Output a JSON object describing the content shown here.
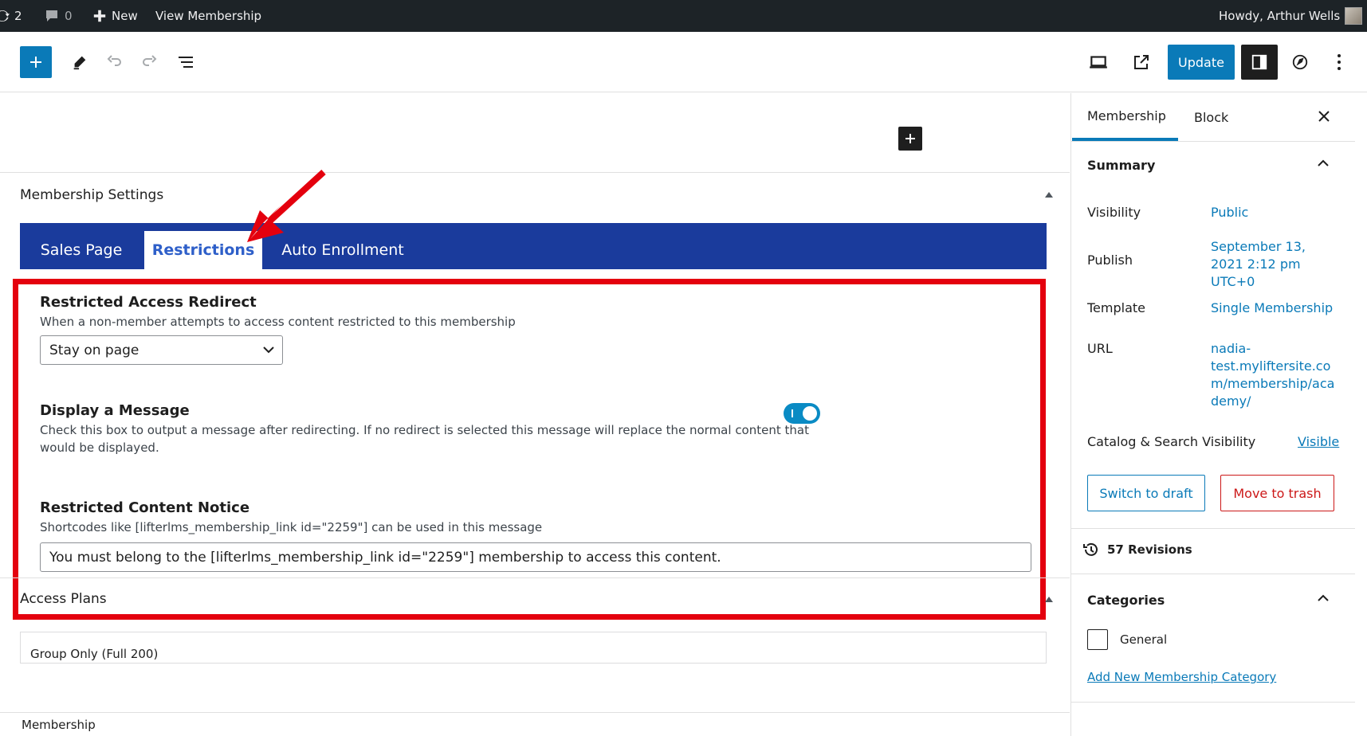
{
  "adminbar": {
    "updates_count": "2",
    "comments_count": "0",
    "new_label": "New",
    "view_label": "View Membership",
    "greeting": "Howdy, Arthur Wells"
  },
  "toolbar": {
    "update_label": "Update"
  },
  "main": {
    "settings_title": "Membership Settings",
    "tabs": [
      "Sales Page",
      "Restrictions",
      "Auto Enrollment"
    ],
    "active_tab": "Restrictions",
    "redirect": {
      "title": "Restricted Access Redirect",
      "description": "When a non-member attempts to access content restricted to this membership",
      "selected": "Stay on page"
    },
    "message": {
      "title": "Display a Message",
      "description_line1": "Check this box to output a message after redirecting. If no redirect is selected this message will replace the normal content that",
      "description_line2": "would be displayed.",
      "enabled": true
    },
    "notice": {
      "title": "Restricted Content Notice",
      "description": "Shortcodes like [lifterlms_membership_link id=\"2259\"] can be used in this message",
      "value": "You must belong to the [lifterlms_membership_link id=\"2259\"] membership to access this content."
    },
    "access_plans_title": "Access Plans",
    "plan_cutoff_text": "Group Only (Full 200)"
  },
  "footer": {
    "breadcrumb": "Membership"
  },
  "sidebar": {
    "tabs": [
      "Membership",
      "Block"
    ],
    "summary_title": "Summary",
    "visibility_label": "Visibility",
    "visibility_value": "Public",
    "publish_label": "Publish",
    "publish_line1": "September 13,",
    "publish_line2": "2021 2:12 pm",
    "publish_line3": "UTC+0",
    "template_label": "Template",
    "template_value": "Single Membership",
    "url_label": "URL",
    "url_line1": "nadia-",
    "url_line2": "test.myliftersite.co",
    "url_line3": "m/membership/aca",
    "url_line4": "demy/",
    "catalog_label": "Catalog & Search Visibility",
    "catalog_value": "Visible",
    "switch_draft_label": "Switch to draft",
    "trash_label": "Move to trash",
    "revisions_label": "57 Revisions",
    "categories_title": "Categories",
    "category_general": "General",
    "add_category_label": "Add New Membership Category"
  },
  "colors": {
    "accent": "#0a7ab8",
    "tab_bar": "#1a3b9c",
    "annotation": "#e4000e",
    "admin_bar": "#1d2327"
  }
}
